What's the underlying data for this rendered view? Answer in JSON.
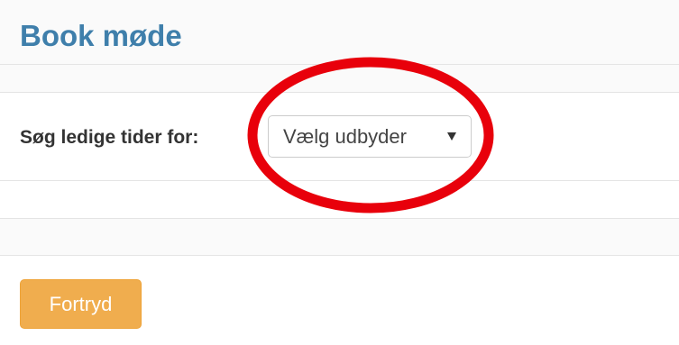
{
  "header": {
    "title": "Book møde"
  },
  "search": {
    "label": "Søg ledige tider for:",
    "provider_select": {
      "selected_value": "Vælg udbyder",
      "icon": "dropdown-arrow-icon"
    }
  },
  "annotation": {
    "type": "highlight-ellipse",
    "color": "#e8000b"
  },
  "actions": {
    "cancel_label": "Fortryd",
    "cancel_color": "#f0ad4e"
  },
  "colors": {
    "title": "#3f7fab",
    "text": "#333333",
    "band_background": "#fafafa",
    "divider": "#e4e4e4"
  }
}
